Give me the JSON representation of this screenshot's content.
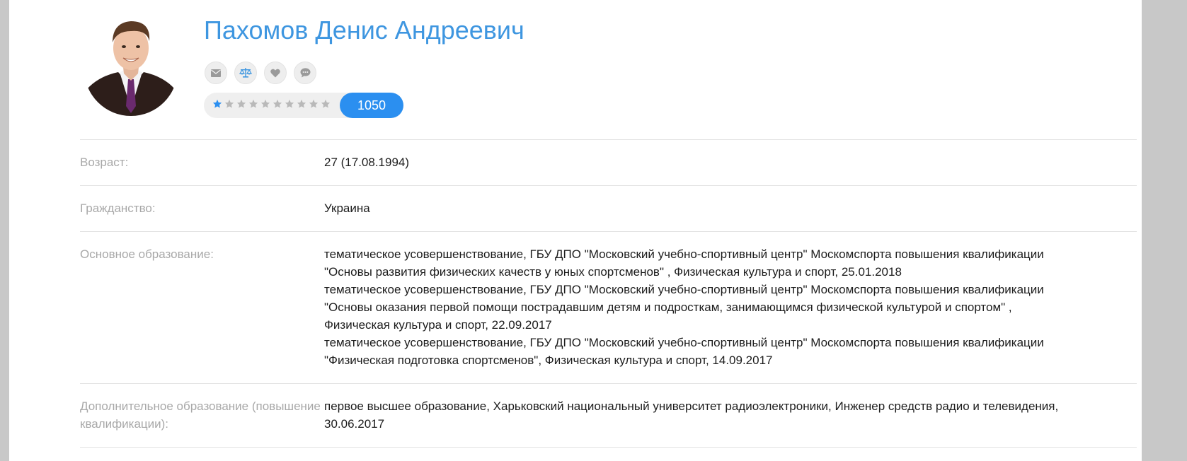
{
  "profile": {
    "name": "Пахомов Денис Андреевич",
    "avatar_icon": "person-photo-icon",
    "actions": [
      {
        "name": "message-button",
        "icon": "envelope-icon"
      },
      {
        "name": "compare-button",
        "icon": "scales-icon"
      },
      {
        "name": "favorite-button",
        "icon": "heart-icon"
      },
      {
        "name": "chat-button",
        "icon": "chat-bubble-icon"
      }
    ],
    "rating": {
      "stars_total": 10,
      "stars_filled": 1,
      "count": "1050",
      "colors": {
        "filled": "#2b8ff0",
        "empty": "#b9b9b9",
        "count_bg": "#2b8ff0"
      }
    }
  },
  "details": [
    {
      "label": "Возраст:",
      "value": [
        "27 (17.08.1994)"
      ]
    },
    {
      "label": "Гражданство:",
      "value": [
        "Украина"
      ]
    },
    {
      "label": "Основное образование:",
      "value": [
        "тематическое усовершенствование, ГБУ ДПО \"Московский учебно-спортивный центр\" Москомспорта повышения квалификации",
        "\"Основы развития физических качеств у юных спортсменов\" , Физическая культура и спорт, 25.01.2018",
        "тематическое усовершенствование, ГБУ ДПО \"Московский учебно-спортивный центр\" Москомспорта повышения квалификации",
        "\"Основы оказания первой помощи пострадавшим детям и подросткам, занимающимся физической культурой и спортом\" ,",
        "Физическая культура и спорт, 22.09.2017",
        "тематическое усовершенствование, ГБУ ДПО \"Московский учебно-спортивный центр\" Москомспорта повышения квалификации",
        "\"Физическая подготовка спортсменов\", Физическая культура и спорт, 14.09.2017"
      ]
    },
    {
      "label": "Дополнительное образование (повышение квалификации):",
      "value": [
        "первое высшее образование, Харьковский национальный университет радиоэлектроники, Инженер средств радио и телевидения,",
        "30.06.2017"
      ]
    }
  ],
  "theme": {
    "accent": "#3e96e0",
    "label_color": "#a8a8a8",
    "divider": "#e2e2e2"
  }
}
